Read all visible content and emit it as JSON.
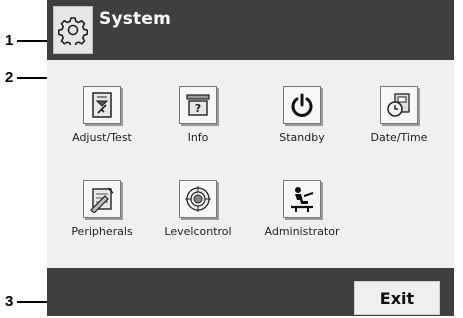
{
  "callouts": [
    "1",
    "2",
    "3"
  ],
  "header": {
    "title": "System",
    "icon": "gear-icon"
  },
  "tiles": [
    {
      "label": "Adjust/Test",
      "icon": "adjust-test-icon"
    },
    {
      "label": "Info",
      "icon": "info-icon"
    },
    {
      "label": "Standby",
      "icon": "power-icon"
    },
    {
      "label": "Date/Time",
      "icon": "date-time-icon"
    },
    {
      "label": "Peripherals",
      "icon": "peripherals-icon"
    },
    {
      "label": "Levelcontrol",
      "icon": "level-control-icon"
    },
    {
      "label": "Administrator",
      "icon": "administrator-icon"
    }
  ],
  "footer": {
    "exit_label": "Exit"
  },
  "colors": {
    "bar": "#3f3f3f",
    "panel": "#f0f0f0",
    "button": "#efefef"
  }
}
